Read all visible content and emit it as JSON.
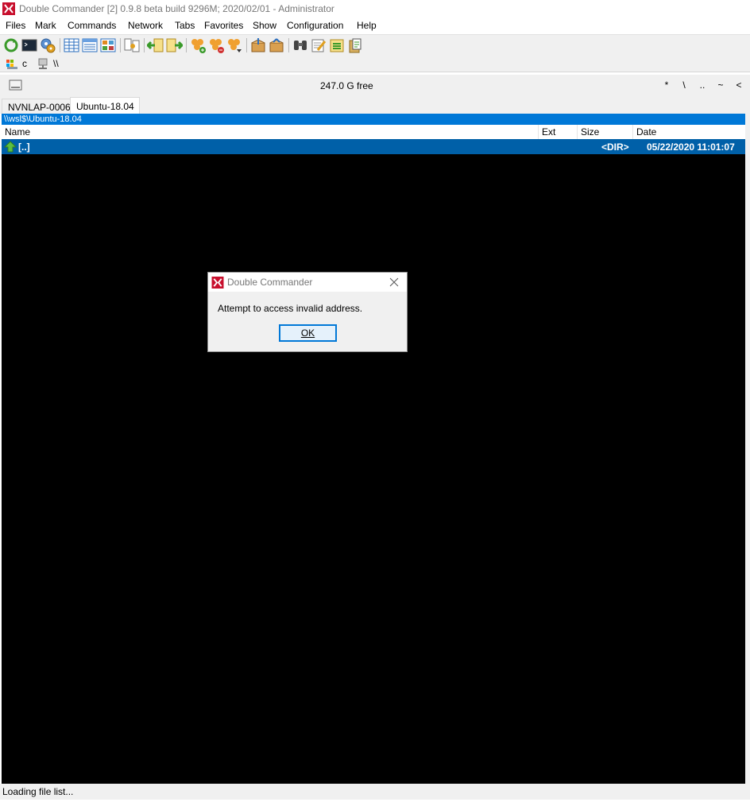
{
  "window": {
    "title": "Double Commander [2] 0.9.8 beta build 9296M; 2020/02/01 - Administrator",
    "app_icon": "double-commander-logo-icon",
    "accent_color": "#0078d7"
  },
  "menu": {
    "items": [
      "Files",
      "Mark",
      "Commands",
      "Network",
      "Tabs",
      "Favorites",
      "Show",
      "Configuration",
      "Help"
    ]
  },
  "toolbar": {
    "buttons": [
      "refresh-icon",
      "terminal-icon",
      "options-gear-icon",
      "brief-view-icon",
      "full-view-icon",
      "thumbnail-view-icon",
      "compare-directories-icon",
      "copy-left-icon",
      "copy-right-icon",
      "add-favorite-icon",
      "remove-favorite-icon",
      "favorite-menu-icon",
      "pack-files-icon",
      "unpack-files-icon",
      "search-binoculars-icon",
      "multi-rename-icon",
      "sync-dirs-icon",
      "clipboard-icon"
    ]
  },
  "drivebar": {
    "drives": [
      {
        "label": "c",
        "icon": "local-drive-icon"
      },
      {
        "label": "\\\\",
        "icon": "network-drive-icon"
      }
    ]
  },
  "freebar": {
    "free_space": "247.0 G free",
    "nav_buttons": [
      "*",
      "\\",
      "..",
      "~",
      "<"
    ]
  },
  "tabs": {
    "items": [
      {
        "label": "NVNLAP-0006",
        "active": false
      },
      {
        "label": "Ubuntu-18.04",
        "active": true
      }
    ]
  },
  "panel": {
    "path": "\\\\wsl$\\Ubuntu-18.04",
    "columns": [
      "Name",
      "Ext",
      "Size",
      "Date"
    ],
    "rows": [
      {
        "name": "[..]",
        "ext": "",
        "size": "<DIR>",
        "date": "05/22/2020 11:01:07",
        "selected": true
      }
    ]
  },
  "status": {
    "text": "Loading file list..."
  },
  "dialog": {
    "title": "Double Commander",
    "message": "Attempt to access invalid address.",
    "ok_label": "OK"
  }
}
